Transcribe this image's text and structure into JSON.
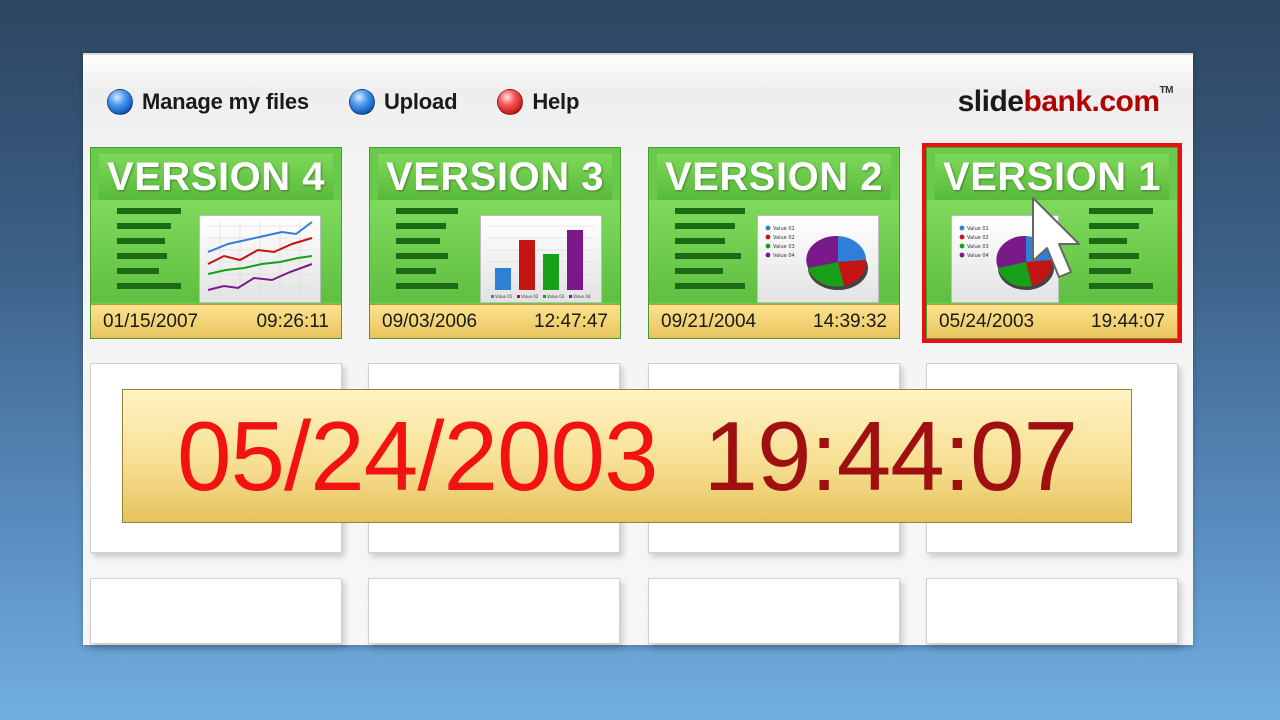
{
  "nav": {
    "items": [
      {
        "label": "Manage my files",
        "icon": "blue-ball-icon"
      },
      {
        "label": "Upload",
        "icon": "blue-ball-icon"
      },
      {
        "label": "Help",
        "icon": "red-ball-icon"
      }
    ]
  },
  "logo": {
    "part1": "slide",
    "part2": "bank.com",
    "tm": "TM"
  },
  "versions": [
    {
      "title": "VERSION 4",
      "date": "01/15/2007",
      "time": "09:26:11",
      "thumb": "line-chart"
    },
    {
      "title": "VERSION 3",
      "date": "09/03/2006",
      "time": "12:47:47",
      "thumb": "bar-chart"
    },
    {
      "title": "VERSION 2",
      "date": "09/21/2004",
      "time": "14:39:32",
      "thumb": "pie-chart"
    },
    {
      "title": "VERSION 1",
      "date": "05/24/2003",
      "time": "19:44:07",
      "thumb": "pie-chart",
      "selected": true
    }
  ],
  "thumbnail_labels": {
    "legend": [
      "Value 01",
      "Value 02",
      "Value 03",
      "Value 04"
    ]
  },
  "highlight": {
    "date": "05/24/2003",
    "time": "19:44:07"
  },
  "colors": {
    "selected_outline": "#e81010",
    "card_green": "#69c94b",
    "date_red": "#f21212",
    "time_red": "#a01010"
  }
}
